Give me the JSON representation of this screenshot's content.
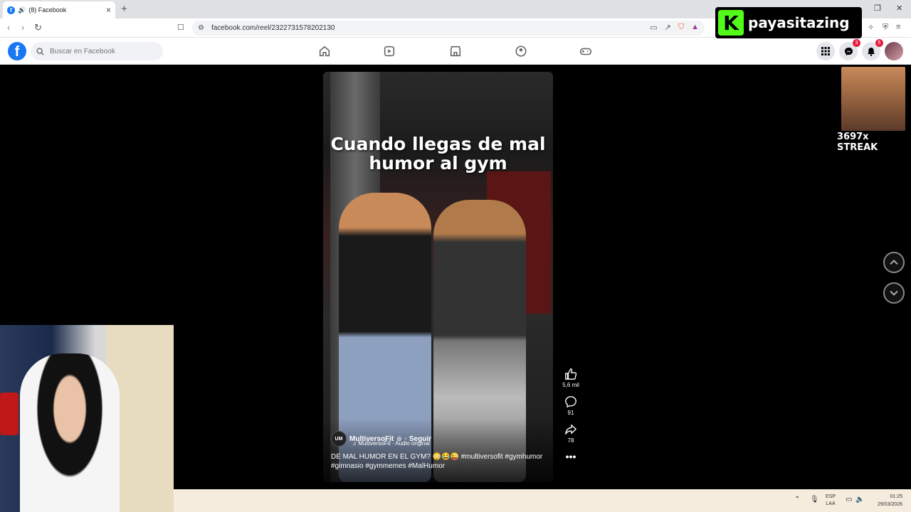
{
  "browser": {
    "tab_title": "(8) Facebook",
    "url": "facebook.com/reel/2322731578202130"
  },
  "facebook": {
    "search_placeholder": "Buscar en Facebook",
    "messenger_badge": "3",
    "notifications_badge": "5"
  },
  "overlay": {
    "kick_channel": "payasitazing",
    "streak": "3697x STREAK"
  },
  "reel": {
    "caption": "Cuando llegas de mal humor al gym",
    "author": "MultiversoFit",
    "author_initials": "UM",
    "follow": "· Seguir",
    "audio": "MultiversoFit · Audio original",
    "description": "DE MAL HUMOR EN EL GYM? 😳😂😜 #multiversofit #gymhumor #gimnasio #gymmemes #MalHumor",
    "likes": "5,6 mil",
    "comments": "91",
    "shares": "78"
  },
  "taskbar": {
    "lang_top": "ESP",
    "lang_bottom": "LAA",
    "time": "01:25",
    "date": "29/03/2026"
  },
  "colors": {
    "facebook_blue": "#1877f2",
    "kick_green": "#53fc18",
    "badge_red": "#e41e3f"
  }
}
